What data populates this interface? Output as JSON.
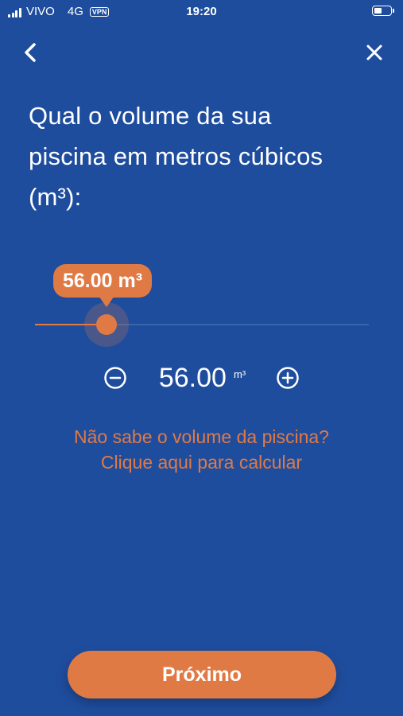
{
  "status_bar": {
    "carrier": "VIVO",
    "network": "4G",
    "vpn": "VPN",
    "time": "19:20"
  },
  "nav": {
    "back_icon": "chevron-left-icon",
    "close_icon": "close-icon"
  },
  "question": {
    "line1": "Qual o volume da sua",
    "line2": "piscina em metros cúbicos",
    "line3": "(m³):"
  },
  "slider": {
    "tooltip": "56.00 m³",
    "value_fraction": 0.215
  },
  "stepper": {
    "decrement_icon": "minus-circle-icon",
    "increment_icon": "plus-circle-icon",
    "value": "56.00",
    "unit": "m³"
  },
  "help_link": {
    "line1": "Não sabe o volume da piscina?",
    "line2": "Clique aqui para calcular"
  },
  "next_button": {
    "label": "Próximo"
  },
  "colors": {
    "background": "#1f4d9e",
    "accent": "#e07a45",
    "text": "#ffffff"
  }
}
